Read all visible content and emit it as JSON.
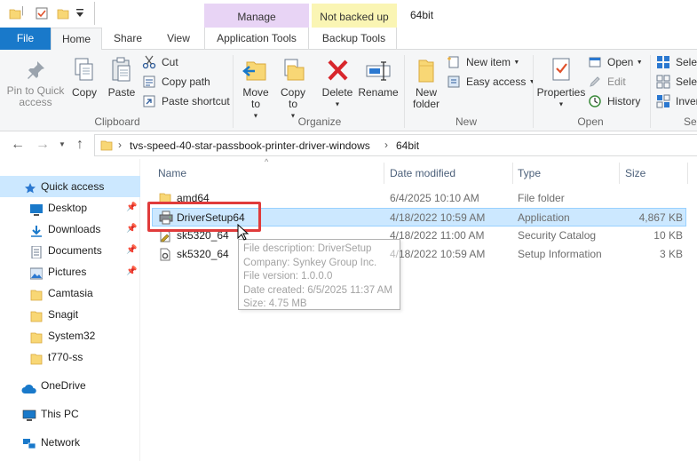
{
  "titlebar": {
    "window_title": "64bit",
    "context_groups": {
      "manage": "Manage",
      "not_backed_up": "Not backed up"
    }
  },
  "tabs": {
    "file": "File",
    "home": "Home",
    "share": "Share",
    "view": "View",
    "app_tools": "Application Tools",
    "backup_tools": "Backup Tools"
  },
  "ribbon": {
    "clipboard": {
      "pin_label": "Pin to Quick access",
      "copy_label": "Copy",
      "paste_label": "Paste",
      "cut_label": "Cut",
      "copy_path_label": "Copy path",
      "paste_shortcut_label": "Paste shortcut",
      "group_label": "Clipboard"
    },
    "organize": {
      "move_to_label": "Move to",
      "copy_to_label": "Copy to",
      "delete_label": "Delete",
      "rename_label": "Rename",
      "group_label": "Organize"
    },
    "new": {
      "new_folder_label": "New folder",
      "new_item_label": "New item",
      "easy_access_label": "Easy access",
      "group_label": "New"
    },
    "open": {
      "properties_label": "Properties",
      "open_label": "Open",
      "edit_label": "Edit",
      "history_label": "History",
      "group_label": "Open"
    },
    "select": {
      "select_all_label": "Selec",
      "select_none_label": "Selec",
      "invert_label": "Inver",
      "group_label": "Se"
    }
  },
  "address": {
    "crumbs": [
      "tvs-speed-40-star-passbook-printer-driver-windows",
      "64bit"
    ]
  },
  "navpane": {
    "items": [
      {
        "label": "Quick access",
        "icon": "star-icon"
      },
      {
        "label": "Desktop",
        "icon": "desktop-icon",
        "pinned": true
      },
      {
        "label": "Downloads",
        "icon": "download-icon",
        "pinned": true
      },
      {
        "label": "Documents",
        "icon": "documents-icon",
        "pinned": true
      },
      {
        "label": "Pictures",
        "icon": "pictures-icon",
        "pinned": true
      },
      {
        "label": "Camtasia",
        "icon": "folder-icon"
      },
      {
        "label": "Snagit",
        "icon": "folder-icon"
      },
      {
        "label": "System32",
        "icon": "folder-icon"
      },
      {
        "label": "t770-ss",
        "icon": "folder-icon"
      },
      {
        "label": "OneDrive",
        "icon": "cloud-icon"
      },
      {
        "label": "This PC",
        "icon": "computer-icon"
      },
      {
        "label": "Network",
        "icon": "network-icon"
      }
    ]
  },
  "filelist": {
    "columns": [
      "Name",
      "Date modified",
      "Type",
      "Size"
    ],
    "rows": [
      {
        "name": "amd64",
        "date": "6/4/2025 10:10 AM",
        "type": "File folder",
        "size": "",
        "icon": "folder-icon"
      },
      {
        "name": "DriverSetup64",
        "date": "4/18/2022 10:59 AM",
        "type": "Application",
        "size": "4,867 KB",
        "icon": "printer-icon",
        "selected": true
      },
      {
        "name": "sk5320_64",
        "date": "4/18/2022 11:00 AM",
        "type": "Security Catalog",
        "size": "10 KB",
        "icon": "catalog-icon"
      },
      {
        "name": "sk5320_64",
        "date": "4/18/2022 10:59 AM",
        "type": "Setup Information",
        "size": "3 KB",
        "icon": "settings-file-icon"
      }
    ]
  },
  "tooltip": {
    "lines": [
      "File description: DriverSetup",
      "Company: Synkey Group Inc.",
      "File version: 1.0.0.0",
      "Date created: 6/5/2025 11:37 AM",
      "Size: 4.75 MB"
    ]
  },
  "colors": {
    "accent": "#1979ca",
    "selection": "#cce8ff",
    "highlight": "#e03b3b",
    "folder": "#f8d775"
  }
}
